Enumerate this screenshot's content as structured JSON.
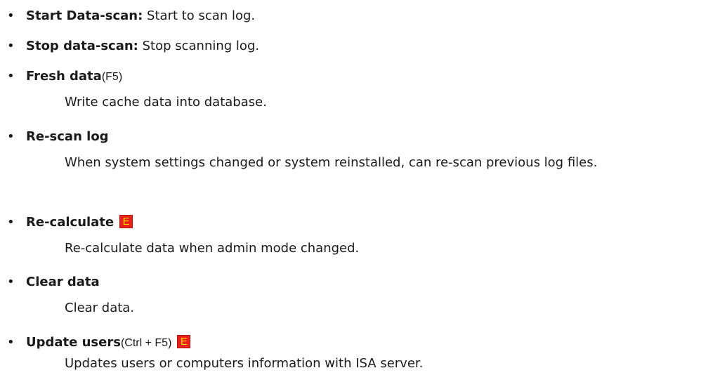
{
  "items": [
    {
      "term": "Start Data-scan:",
      "inline_text": " Start to scan log."
    },
    {
      "term": "Stop data-scan:",
      "inline_text": " Stop scanning log."
    },
    {
      "term": "Fresh data",
      "shortcut": "(F5)",
      "description": "Write cache data into database."
    },
    {
      "term": "Re-scan log",
      "description": "When system settings changed or system reinstalled, can re-scan previous log files."
    },
    {
      "term": "Re-calculate",
      "badge": "E",
      "description": "Re-calculate data when admin mode changed."
    },
    {
      "term": "Clear data",
      "description": "Clear data."
    },
    {
      "term": "Update users",
      "shortcut": "(Ctrl + F5)",
      "badge": "E",
      "description": "Updates users or computers information with ISA server."
    }
  ],
  "colors": {
    "text": "#1a1a1a",
    "badge_background": "#e8201a",
    "badge_letter": "#ffd500"
  },
  "bullet_glyph": "•"
}
